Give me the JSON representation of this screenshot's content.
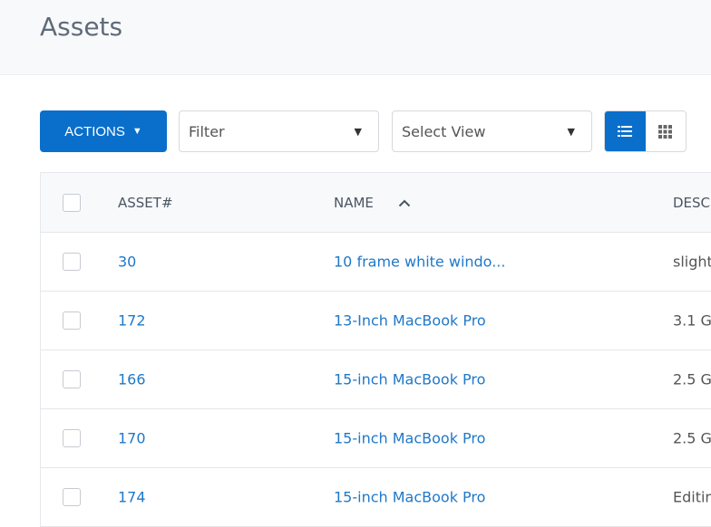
{
  "page": {
    "title": "Assets"
  },
  "toolbar": {
    "actions_label": "ACTIONS",
    "filter": {
      "value": "Filter"
    },
    "view": {
      "value": "Select View"
    },
    "view_modes": [
      {
        "icon": "list-icon",
        "active": true
      },
      {
        "icon": "grid-icon",
        "active": false
      }
    ]
  },
  "colors": {
    "accent": "#0a6fca",
    "link": "#1f78c8"
  },
  "table": {
    "columns": [
      "ASSET#",
      "NAME",
      "DESC"
    ],
    "sort": {
      "column": "NAME",
      "direction": "ascending"
    },
    "rows": [
      {
        "asset": "30",
        "name": "10 frame white windo...",
        "desc": "slight"
      },
      {
        "asset": "172",
        "name": "13-Inch MacBook Pro",
        "desc": "3.1 G"
      },
      {
        "asset": "166",
        "name": "15-inch MacBook Pro",
        "desc": "2.5 G"
      },
      {
        "asset": "170",
        "name": "15-inch MacBook Pro",
        "desc": "2.5 G"
      },
      {
        "asset": "174",
        "name": "15-inch MacBook Pro",
        "desc": "Editin"
      }
    ]
  }
}
